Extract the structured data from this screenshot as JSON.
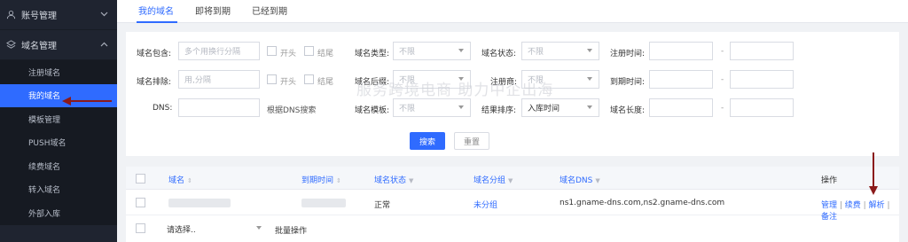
{
  "sidebar": {
    "groups": [
      {
        "label": "账号管理",
        "icon": "user-icon",
        "expanded": false
      },
      {
        "label": "域名管理",
        "icon": "layers-icon",
        "expanded": true
      }
    ],
    "items": [
      {
        "label": "注册域名"
      },
      {
        "label": "我的域名",
        "active": true
      },
      {
        "label": "模板管理"
      },
      {
        "label": "PUSH域名"
      },
      {
        "label": "续费域名"
      },
      {
        "label": "转入域名"
      },
      {
        "label": "外部入库"
      }
    ]
  },
  "tabs": [
    {
      "label": "我的域名",
      "active": true
    },
    {
      "label": "即将到期"
    },
    {
      "label": "已经到期"
    }
  ],
  "filters": {
    "contains_label": "域名包含:",
    "contains_placeholder": "多个用换行分隔",
    "exclude_label": "域名排除:",
    "exclude_placeholder": "用,分隔",
    "dns_label": "DNS:",
    "dns_hint": "根据DNS搜索",
    "check_start": "开头",
    "check_end": "结尾",
    "type_label": "域名类型:",
    "type_value": "不限",
    "suffix_label": "域名后缀:",
    "suffix_value": "不限",
    "template_label": "域名模板:",
    "template_value": "不限",
    "status_label": "域名状态:",
    "status_value": "不限",
    "registrar_label": "注册商:",
    "registrar_value": "不限",
    "sort_label": "结果排序:",
    "sort_value": "入库时间",
    "reg_time_label": "注册时间:",
    "expire_time_label": "到期时间:",
    "length_label": "域名长度:",
    "range_sep": "-",
    "search_button": "搜索",
    "reset_button": "重置"
  },
  "table": {
    "headers": [
      "域名",
      "到期时间",
      "域名状态",
      "域名分组",
      "域名DNS",
      "操作"
    ],
    "rows": [
      {
        "status": "正常",
        "group": "未分组",
        "dns": "ns1.gname-dns.com,ns2.gname-dns.com",
        "ops": [
          "管理",
          "续费",
          "解析",
          "备注"
        ]
      }
    ],
    "footer": {
      "select_placeholder": "请选择..",
      "batch_label": "批量操作"
    }
  },
  "watermark": {
    "slogan": "服务跨境电商 助力中企出海"
  },
  "colors": {
    "accent": "#2f6bff",
    "sidebar_bg": "#1f2430",
    "arrow": "#8b1a1a"
  }
}
